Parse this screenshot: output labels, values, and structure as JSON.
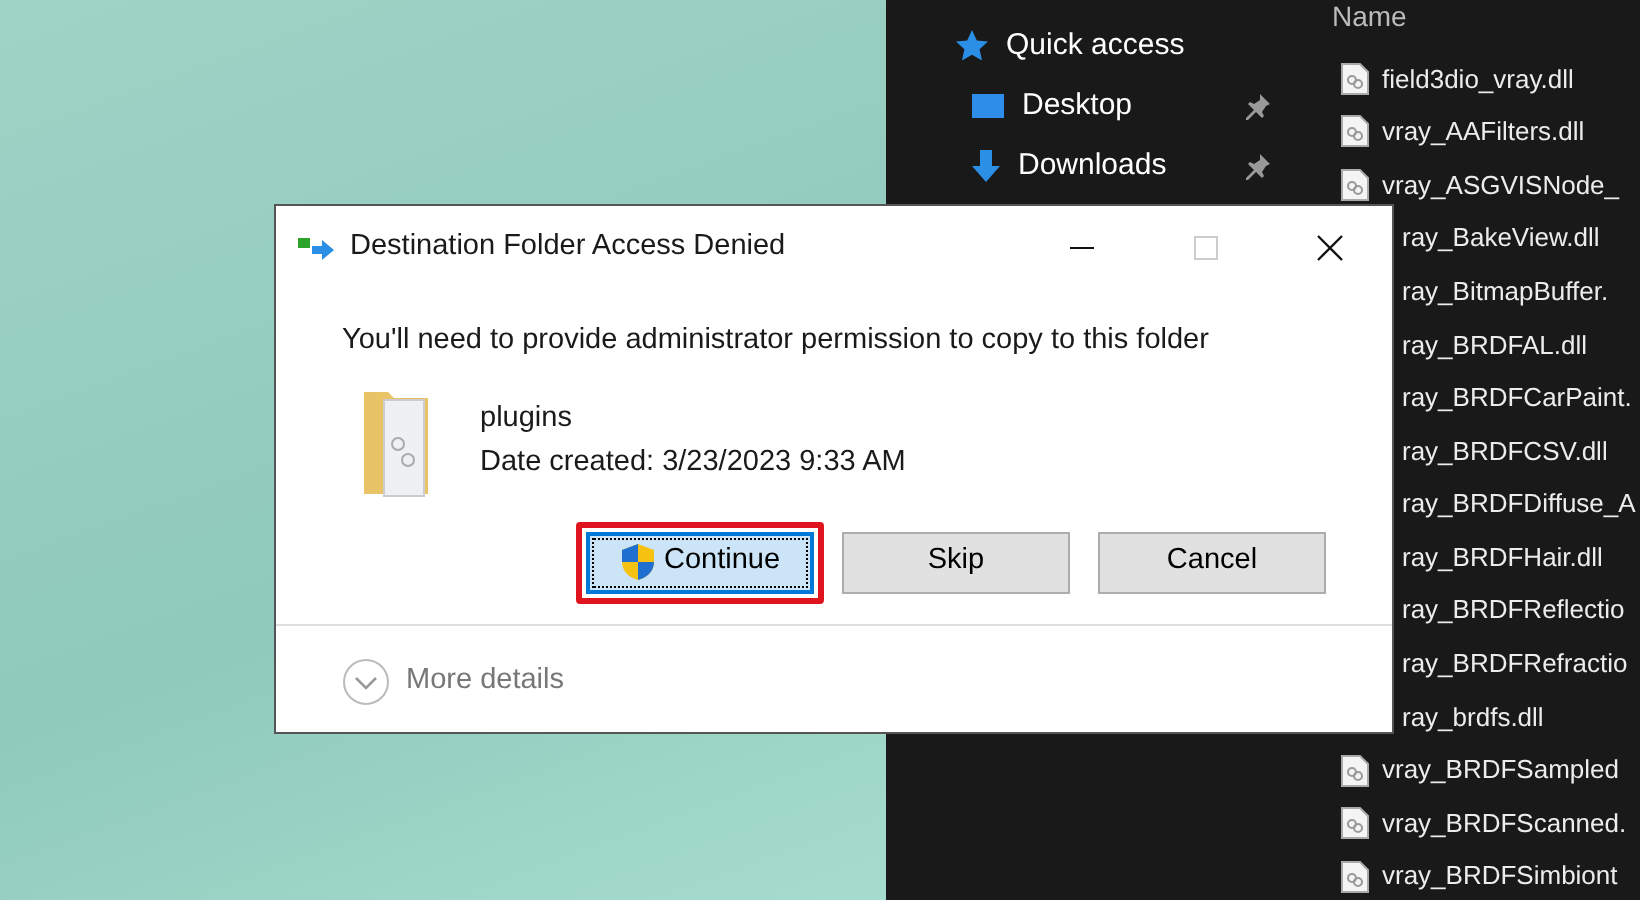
{
  "navigation_pane": {
    "items": [
      {
        "label": "Quick access",
        "kind": "star",
        "pinned": false
      },
      {
        "label": "Desktop",
        "kind": "desktop",
        "pinned": true
      },
      {
        "label": "Downloads",
        "kind": "download",
        "pinned": true
      }
    ]
  },
  "file_list": {
    "header": "Name",
    "files": [
      {
        "name": "field3dio_vray.dll",
        "kind": "full"
      },
      {
        "name": "vray_AAFilters.dll",
        "kind": "full"
      },
      {
        "name": "vray_ASGVISNode_",
        "kind": "full"
      },
      {
        "name": "ray_BakeView.dll",
        "kind": "covered"
      },
      {
        "name": "ray_BitmapBuffer.",
        "kind": "covered"
      },
      {
        "name": "ray_BRDFAL.dll",
        "kind": "covered"
      },
      {
        "name": "ray_BRDFCarPaint.",
        "kind": "covered"
      },
      {
        "name": "ray_BRDFCSV.dll",
        "kind": "covered"
      },
      {
        "name": "ray_BRDFDiffuse_A",
        "kind": "covered"
      },
      {
        "name": "ray_BRDFHair.dll",
        "kind": "covered"
      },
      {
        "name": "ray_BRDFReflectio",
        "kind": "covered"
      },
      {
        "name": "ray_BRDFRefractio",
        "kind": "covered"
      },
      {
        "name": "ray_brdfs.dll",
        "kind": "covered"
      },
      {
        "name": "vray_BRDFSampled",
        "kind": "full"
      },
      {
        "name": "vray_BRDFScanned.",
        "kind": "full"
      },
      {
        "name": "vray_BRDFSimbiont",
        "kind": "full"
      }
    ]
  },
  "dialog": {
    "title": "Destination Folder Access Denied",
    "message": "You'll need to provide administrator permission to copy to this folder",
    "folder": {
      "name": "plugins",
      "date_created": "Date created: 3/23/2023 9:33 AM"
    },
    "buttons": [
      {
        "label": "Continue",
        "kind": "shield",
        "selected": true,
        "highlighted": true
      },
      {
        "label": "Skip",
        "kind": "plain",
        "selected": false,
        "highlighted": false
      },
      {
        "label": "Cancel",
        "kind": "plain",
        "selected": false,
        "highlighted": false
      }
    ],
    "more_details": "More details"
  }
}
